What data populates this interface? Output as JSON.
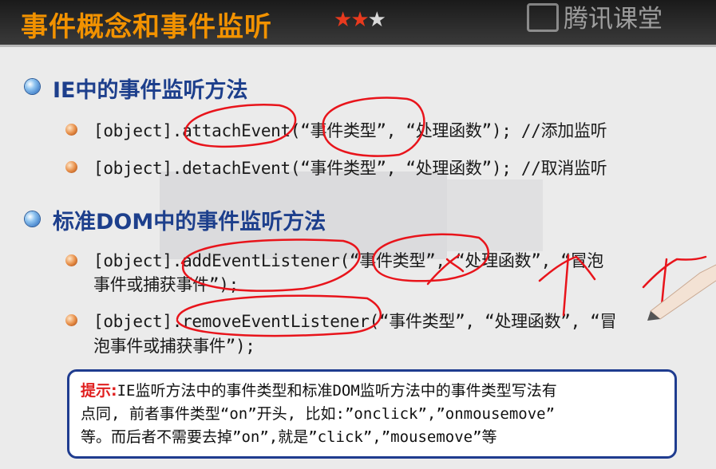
{
  "slide": {
    "title": "事件概念和事件监听",
    "stars": {
      "filled": 2,
      "total": 3
    },
    "watermark": "腾讯课堂"
  },
  "sections": [
    {
      "heading": "IE中的事件监听方法",
      "items": [
        "[object].attachEvent(“事件类型”, “处理函数”); //添加监听",
        "[object].detachEvent(“事件类型”, “处理函数”); //取消监听"
      ]
    },
    {
      "heading": "标准DOM中的事件监听方法",
      "items": [
        {
          "line1": "[object].addEventListener(“事件类型”, “处理函数”, “冒泡",
          "line2": "事件或捕获事件”);"
        },
        {
          "line1": "[object].removeEventListener(“事件类型”, “处理函数”, “冒",
          "line2": "泡事件或捕获事件”);"
        }
      ]
    }
  ],
  "tip": {
    "label": "提示:",
    "line1": "IE监听方法中的事件类型和标准DOM监听方法中的事件类型写法有",
    "line2": "点同, 前者事件类型“on”开头, 比如:”onclick”,”onmousemove”",
    "line3": "等。而后者不需要去掉”on”,就是”click”,”mousemove”等"
  },
  "colors": {
    "title": "#f29200",
    "heading": "#1d3f8c",
    "annotation": "#e8141b",
    "tip_border": "#1f3c8f",
    "tip_label": "#e02020"
  }
}
